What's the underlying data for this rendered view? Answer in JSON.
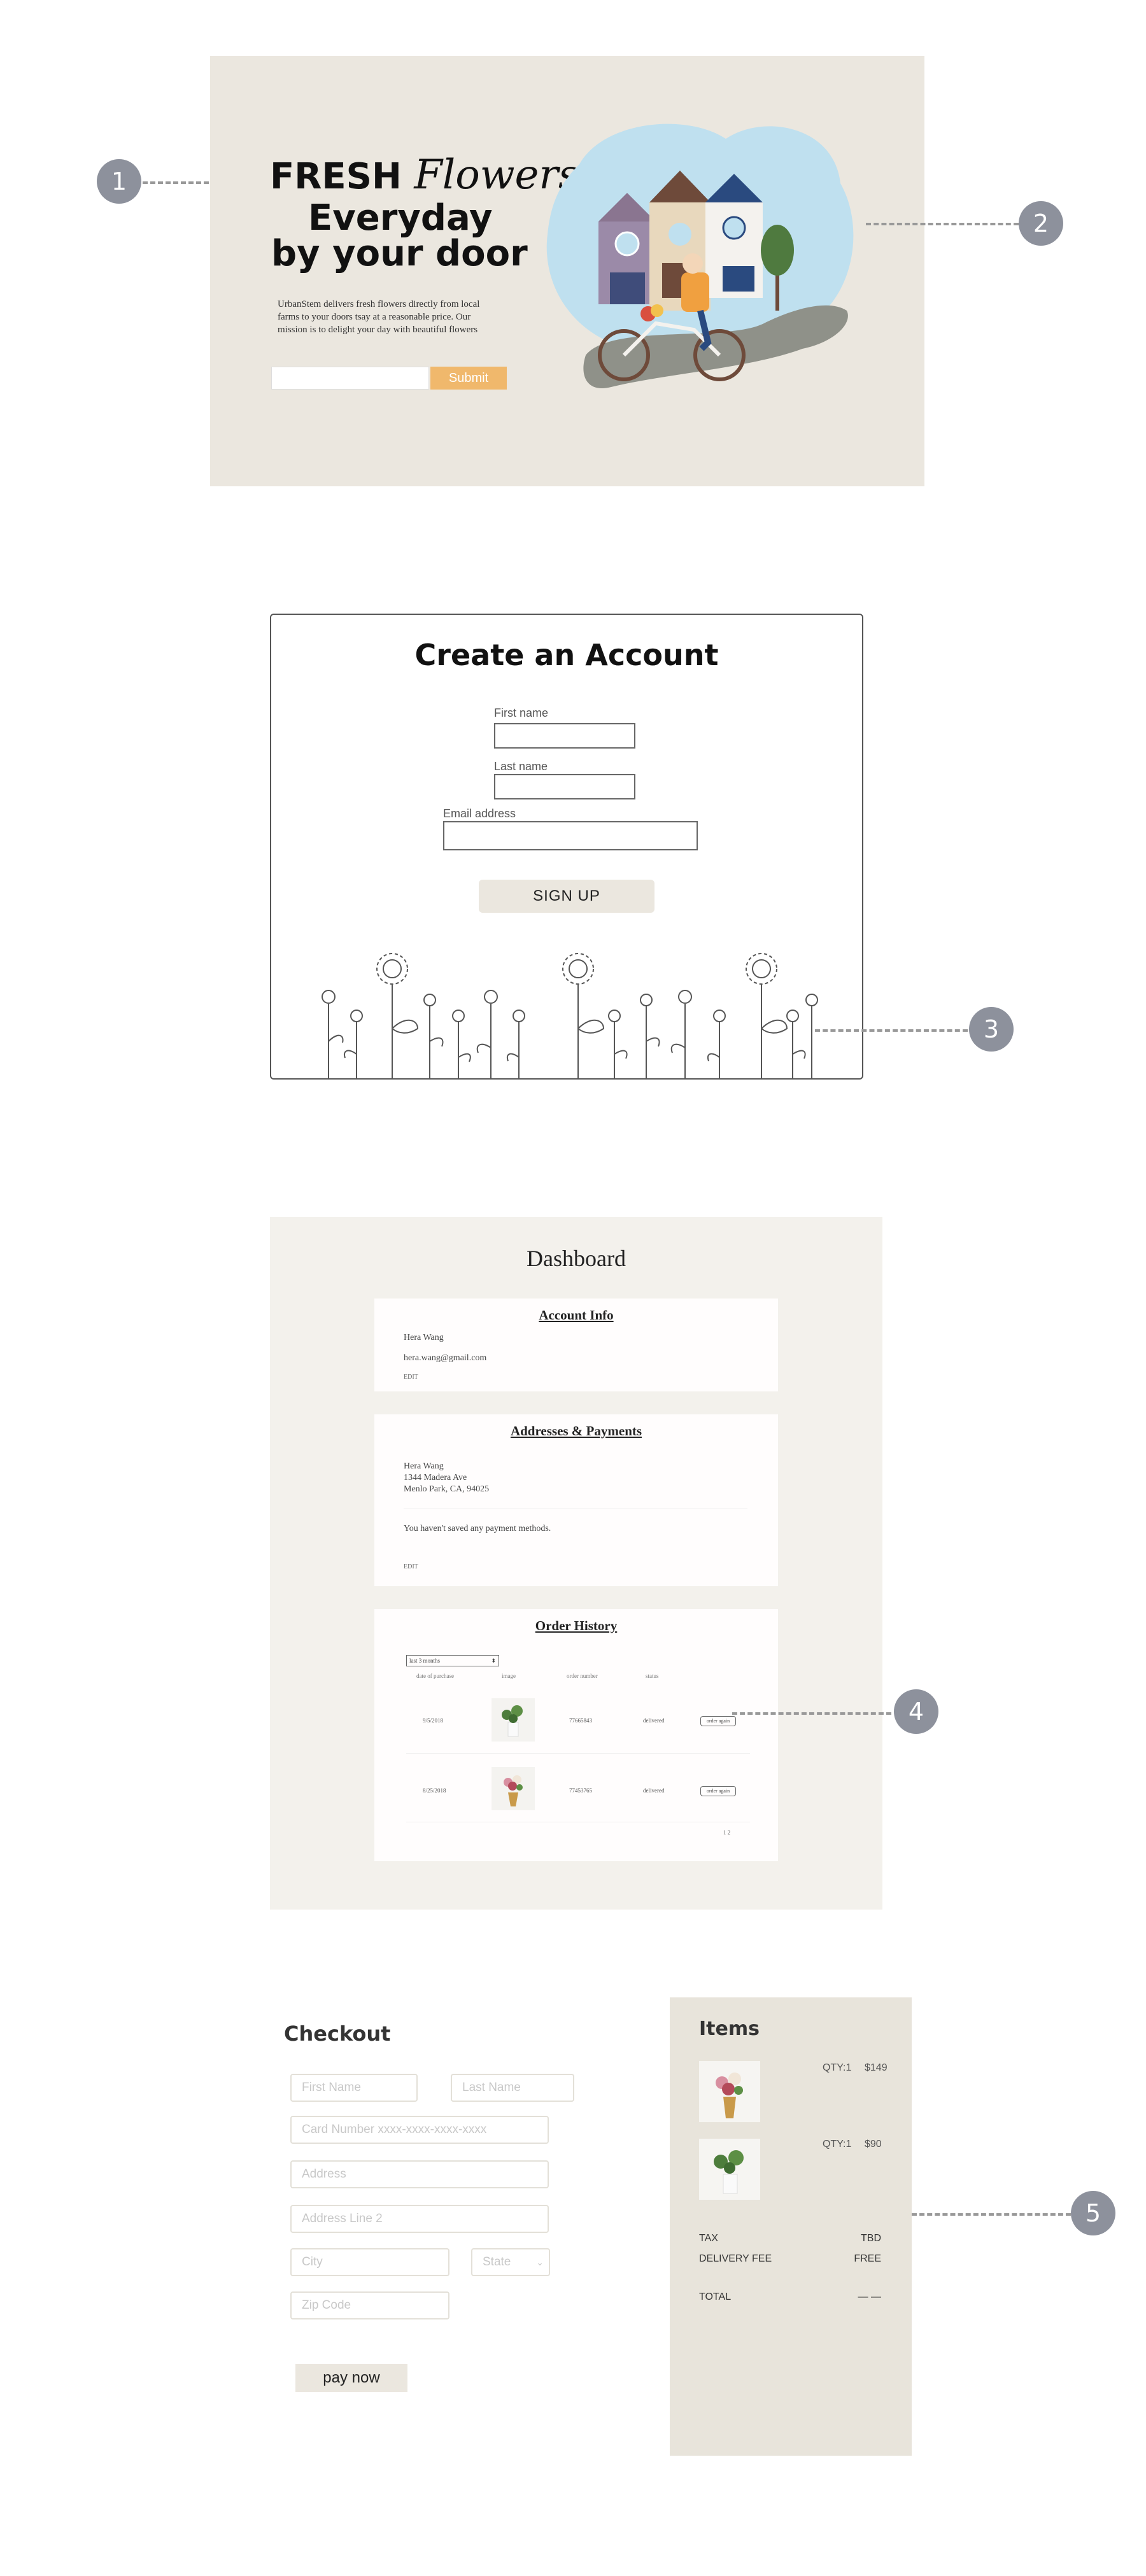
{
  "callouts": [
    "1",
    "2",
    "3",
    "4",
    "5"
  ],
  "hero": {
    "title_fresh": "FRESH",
    "title_script": "Flowers",
    "title_line2": "Everyday",
    "title_line3": "by your door",
    "description": "UrbanStem delivers fresh flowers directly from local farms to your doors tsay at a reasonable price. Our mission is to delight your day with beautiful flowers",
    "submit_label": "Submit",
    "illustration_icon": "bike-delivery-houses-illustration"
  },
  "account": {
    "title": "Create an Account",
    "first_name_label": "First name",
    "last_name_label": "Last name",
    "email_label": "Email address",
    "signup_label": "SIGN UP",
    "decoration_icon": "flower-line-art"
  },
  "dashboard": {
    "title": "Dashboard",
    "account_info": {
      "title": "Account Info",
      "name": "Hera Wang",
      "email": "hera.wang@gmail.com",
      "edit": "EDIT"
    },
    "addresses": {
      "title": "Addresses & Payments",
      "name": "Hera Wang",
      "street": "1344 Madera Ave",
      "city": "Menlo Park, CA, 94025",
      "payment_note": "You haven't saved any payment methods.",
      "edit": "EDIT"
    },
    "orders": {
      "title": "Order History",
      "filter": "last 3 months",
      "columns": [
        "date of purchase",
        "image",
        "order number",
        "status"
      ],
      "rows": [
        {
          "date": "9/5/2018",
          "order_number": "77665843",
          "status": "delivered",
          "button": "order again"
        },
        {
          "date": "8/25/2018",
          "order_number": "77453765",
          "status": "delivered",
          "button": "order again"
        }
      ],
      "pager": "1 2"
    }
  },
  "checkout": {
    "title": "Checkout",
    "placeholders": {
      "first_name": "First Name",
      "last_name": "Last Name",
      "card_number": "Card Number   xxxx-xxxx-xxxx-xxxx",
      "address": "Address",
      "address2": "Address Line 2",
      "city": "City",
      "state": "State",
      "zip": "Zip Code"
    },
    "pay_label": "pay now",
    "items": {
      "title": "Items",
      "list": [
        {
          "qty": "QTY:1",
          "price": "$149"
        },
        {
          "qty": "QTY:1",
          "price": "$90"
        }
      ],
      "tax_label": "TAX",
      "tax_value": "TBD",
      "delivery_label": "DELIVERY FEE",
      "delivery_value": "FREE",
      "total_label": "TOTAL",
      "total_value": "— —"
    }
  },
  "colors": {
    "beige": "#ebe7df",
    "accent_orange": "#f0b86c",
    "callout_gray": "#8d919c",
    "sky_blue": "#bfe0ef"
  }
}
